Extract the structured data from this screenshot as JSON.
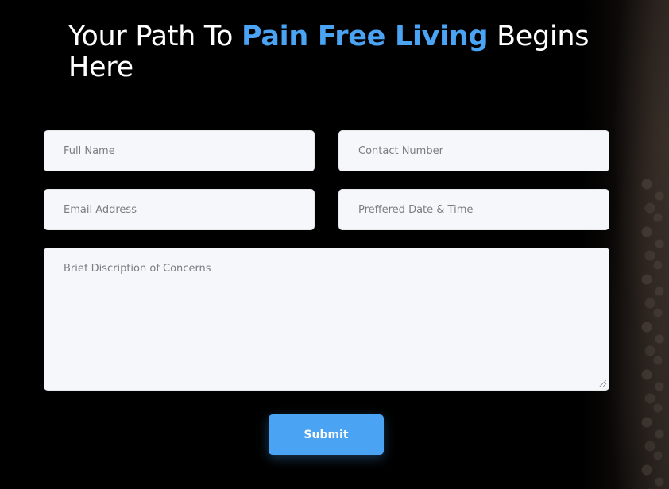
{
  "heading": {
    "part1": "Your Path To ",
    "highlight": "Pain Free Living",
    "part2": " Begins Here"
  },
  "form": {
    "full_name_placeholder": "Full Name",
    "contact_number_placeholder": "Contact Number",
    "email_placeholder": "Email Address",
    "preferred_datetime_placeholder": "Preffered Date & Time",
    "concerns_placeholder": "Brief Discription of Concerns",
    "submit_label": "Submit"
  },
  "colors": {
    "accent": "#4aa3f3",
    "background": "#000000",
    "field_background": "#f5f7fb"
  }
}
